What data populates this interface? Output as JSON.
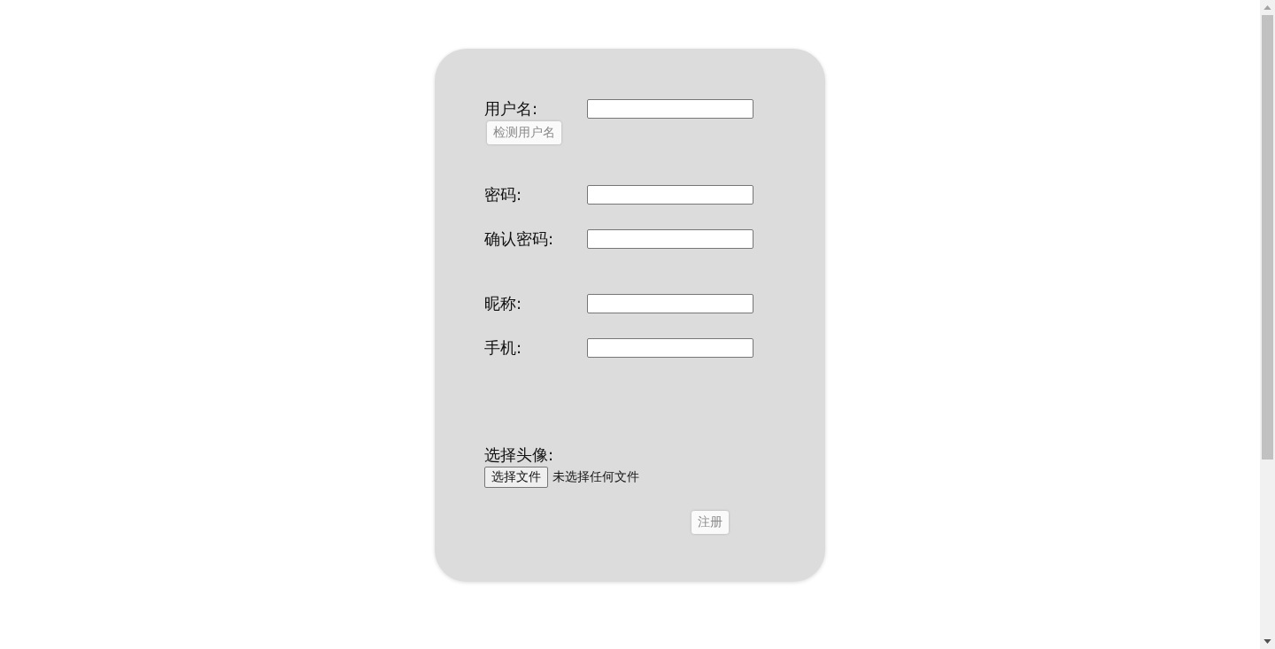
{
  "form": {
    "groups": [
      {
        "fields": [
          {
            "kind": "text",
            "label": "用户名:"
          }
        ],
        "button": "检测用户名"
      },
      {
        "fields": [
          {
            "kind": "password",
            "label": "密码:"
          },
          {
            "kind": "password",
            "label": "确认密码:"
          }
        ]
      },
      {
        "fields": [
          {
            "kind": "text",
            "label": "昵称:"
          },
          {
            "kind": "text",
            "label": "手机:"
          }
        ]
      },
      {
        "fields": [
          {
            "kind": "file",
            "label": "选择头像:",
            "button": "选择文件",
            "status": "未选择任何文件"
          }
        ]
      }
    ],
    "submit": "注册"
  }
}
